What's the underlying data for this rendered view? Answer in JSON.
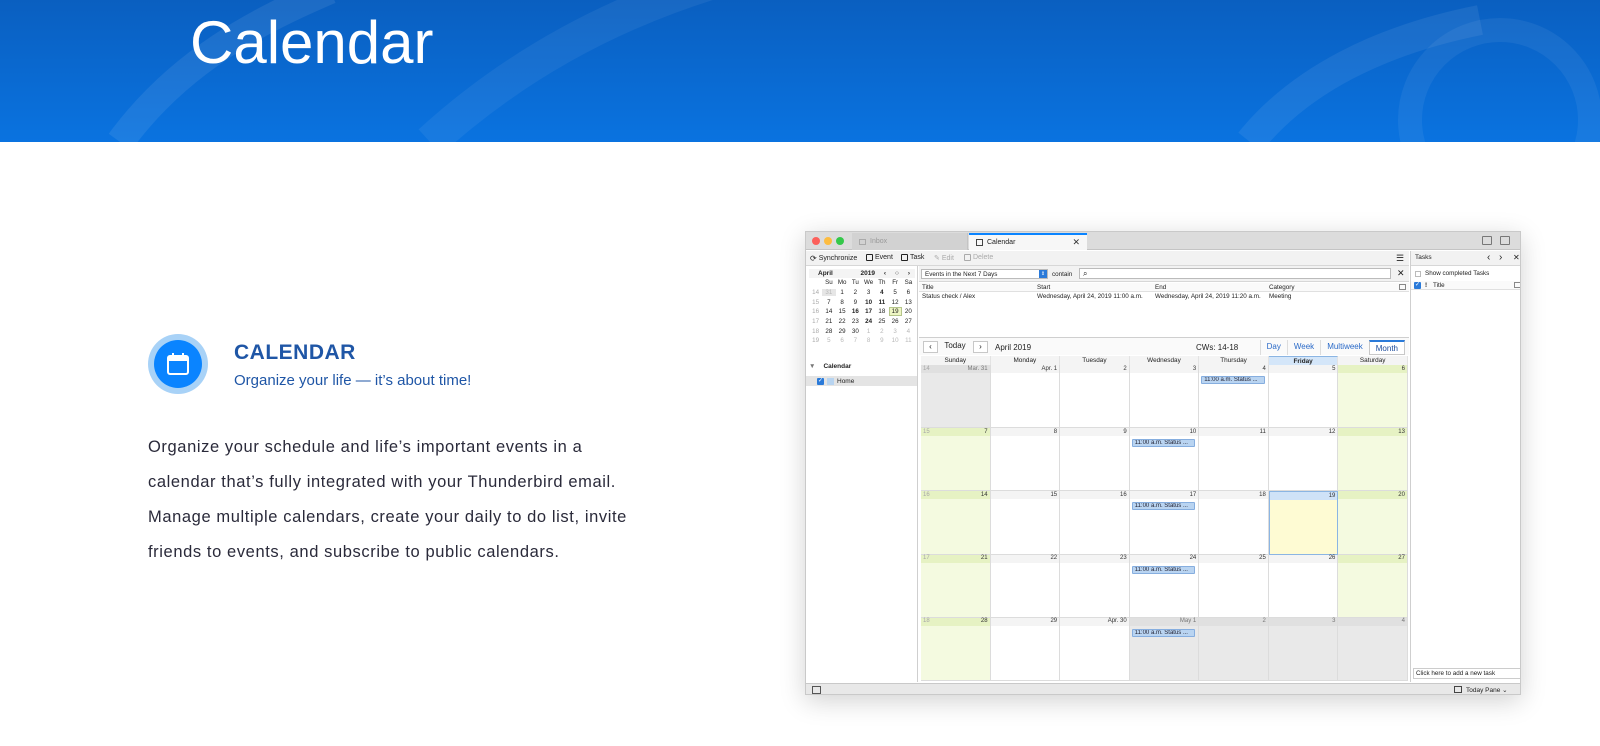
{
  "hero": {
    "title": "Calendar"
  },
  "feature": {
    "icon": "calendar-icon",
    "title": "CALENDAR",
    "subtitle": "Organize your life — it’s about time!",
    "body_lines": [
      "Organize your schedule and life’s important events in a",
      "calendar that’s fully integrated with your Thunderbird email.",
      "Manage multiple calendars, create your daily to do list, invite",
      "friends to events, and subscribe to public calendars."
    ]
  },
  "app": {
    "tabs": {
      "inbox": "Inbox",
      "calendar": "Calendar"
    },
    "toolbar": {
      "synchronize": "Synchronize",
      "event": "Event",
      "task": "Task",
      "edit": "Edit",
      "delete": "Delete"
    },
    "minical": {
      "month": "April",
      "year": "2019",
      "weekdays": [
        "Su",
        "Mo",
        "Tu",
        "We",
        "Th",
        "Fr",
        "Sa"
      ],
      "weeks": [
        {
          "wk": "14",
          "days": [
            "31",
            "1",
            "2",
            "3",
            "4",
            "5",
            "6"
          ]
        },
        {
          "wk": "15",
          "days": [
            "7",
            "8",
            "9",
            "10",
            "11",
            "12",
            "13"
          ]
        },
        {
          "wk": "16",
          "days": [
            "14",
            "15",
            "16",
            "17",
            "18",
            "19",
            "20"
          ]
        },
        {
          "wk": "17",
          "days": [
            "21",
            "22",
            "23",
            "24",
            "25",
            "26",
            "27"
          ]
        },
        {
          "wk": "18",
          "days": [
            "28",
            "29",
            "30",
            "1",
            "2",
            "3",
            "4"
          ]
        },
        {
          "wk": "19",
          "days": [
            "5",
            "6",
            "7",
            "8",
            "9",
            "10",
            "11"
          ]
        }
      ]
    },
    "calendar_list": {
      "header": "Calendar",
      "items": [
        "Home"
      ]
    },
    "filter": {
      "selected": "Events in the Next 7 Days",
      "contain": "contain",
      "search_value": ""
    },
    "events_table": {
      "headers": [
        "Title",
        "Start",
        "End",
        "Category"
      ],
      "rows": [
        [
          "Status check / Alex",
          "Wednesday, April 24, 2019 11:00 a.m.",
          "Wednesday, April 24, 2019 11:20 a.m.",
          "Meeting"
        ]
      ]
    },
    "nav": {
      "today": "Today",
      "month_label": "April 2019",
      "cws": "CWs: 14-18",
      "views": [
        "Day",
        "Week",
        "Multiweek",
        "Month"
      ],
      "active_view": "Month"
    },
    "month_grid": {
      "day_names": [
        "Sunday",
        "Monday",
        "Tuesday",
        "Wednesday",
        "Thursday",
        "Friday",
        "Saturday"
      ],
      "weeks": [
        {
          "wk": "14",
          "days": [
            "Mar. 31",
            "Apr. 1",
            "2",
            "3",
            "4",
            "5",
            "6"
          ]
        },
        {
          "wk": "15",
          "days": [
            "7",
            "8",
            "9",
            "10",
            "11",
            "12",
            "13"
          ]
        },
        {
          "wk": "16",
          "days": [
            "14",
            "15",
            "16",
            "17",
            "18",
            "19",
            "20"
          ]
        },
        {
          "wk": "17",
          "days": [
            "21",
            "22",
            "23",
            "24",
            "25",
            "26",
            "27"
          ]
        },
        {
          "wk": "18",
          "days": [
            "28",
            "29",
            "Apr. 30",
            "May 1",
            "2",
            "3",
            "4"
          ]
        }
      ],
      "event_label": "11:00 a.m. Status ...",
      "events": [
        [
          0,
          4
        ],
        [
          1,
          3
        ],
        [
          2,
          3
        ],
        [
          3,
          3
        ],
        [
          4,
          3
        ]
      ]
    },
    "tasks": {
      "header": "Tasks",
      "show_completed": "Show completed Tasks",
      "col_title": "Title",
      "new_task_placeholder": "Click here to add a new task"
    },
    "statusbar": {
      "today_pane": "Today Pane"
    },
    "colors": {
      "accent": "#0a84ff",
      "weekend": "#f4fae0",
      "today": "#fefbd3",
      "event": "#b9d4f1"
    }
  }
}
